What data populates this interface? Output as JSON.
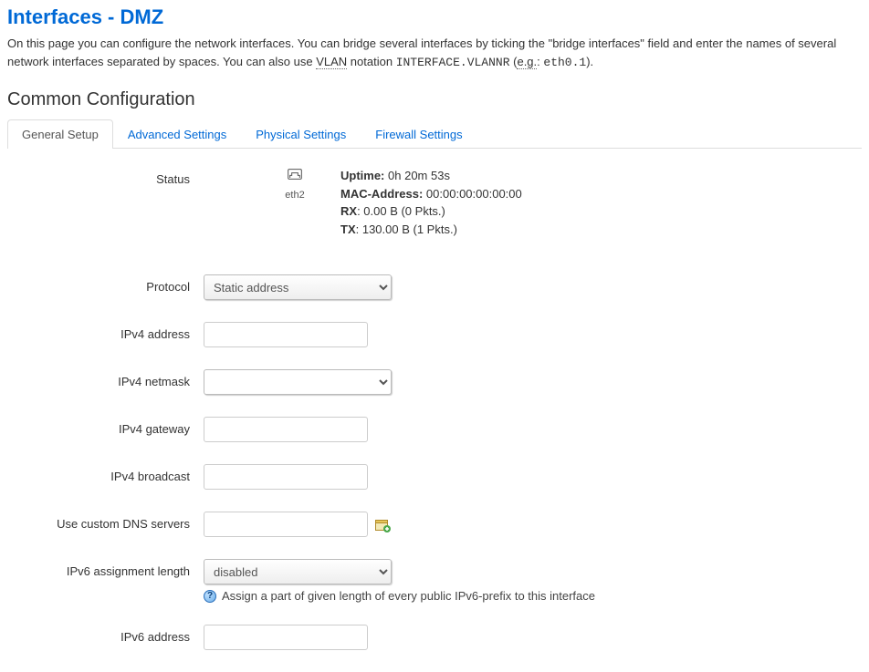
{
  "page": {
    "title": "Interfaces - DMZ",
    "description_pre": "On this page you can configure the network interfaces. You can bridge several interfaces by ticking the \"bridge interfaces\" field and enter the names of several network interfaces separated by spaces. You can also use ",
    "vlan_term": "VLAN",
    "description_mid": " notation ",
    "notation": "INTERFACE.VLANNR",
    "description_eg_open": " (",
    "eg_label": "e.g.",
    "description_eg_colon": ": ",
    "eg_value": "eth0.1",
    "description_close": ")."
  },
  "section": {
    "title": "Common Configuration",
    "tabs": [
      "General Setup",
      "Advanced Settings",
      "Physical Settings",
      "Firewall Settings"
    ]
  },
  "status": {
    "label": "Status",
    "if_name": "eth2",
    "uptime_label": "Uptime:",
    "uptime_value": "0h 20m 53s",
    "mac_label": "MAC-Address:",
    "mac_value": "00:00:00:00:00:00",
    "rx_label": "RX",
    "rx_value": ": 0.00 B (0 Pkts.)",
    "tx_label": "TX",
    "tx_value": ": 130.00 B (1 Pkts.)"
  },
  "fields": {
    "protocol": {
      "label": "Protocol",
      "value": "Static address"
    },
    "ipv4_address": {
      "label": "IPv4 address"
    },
    "ipv4_netmask": {
      "label": "IPv4 netmask",
      "value": ""
    },
    "ipv4_gateway": {
      "label": "IPv4 gateway"
    },
    "ipv4_broadcast": {
      "label": "IPv4 broadcast"
    },
    "dns": {
      "label": "Use custom DNS servers"
    },
    "ipv6_assign": {
      "label": "IPv6 assignment length",
      "value": "disabled",
      "hint": "Assign a part of given length of every public IPv6-prefix to this interface"
    },
    "ipv6_address": {
      "label": "IPv6 address"
    }
  }
}
